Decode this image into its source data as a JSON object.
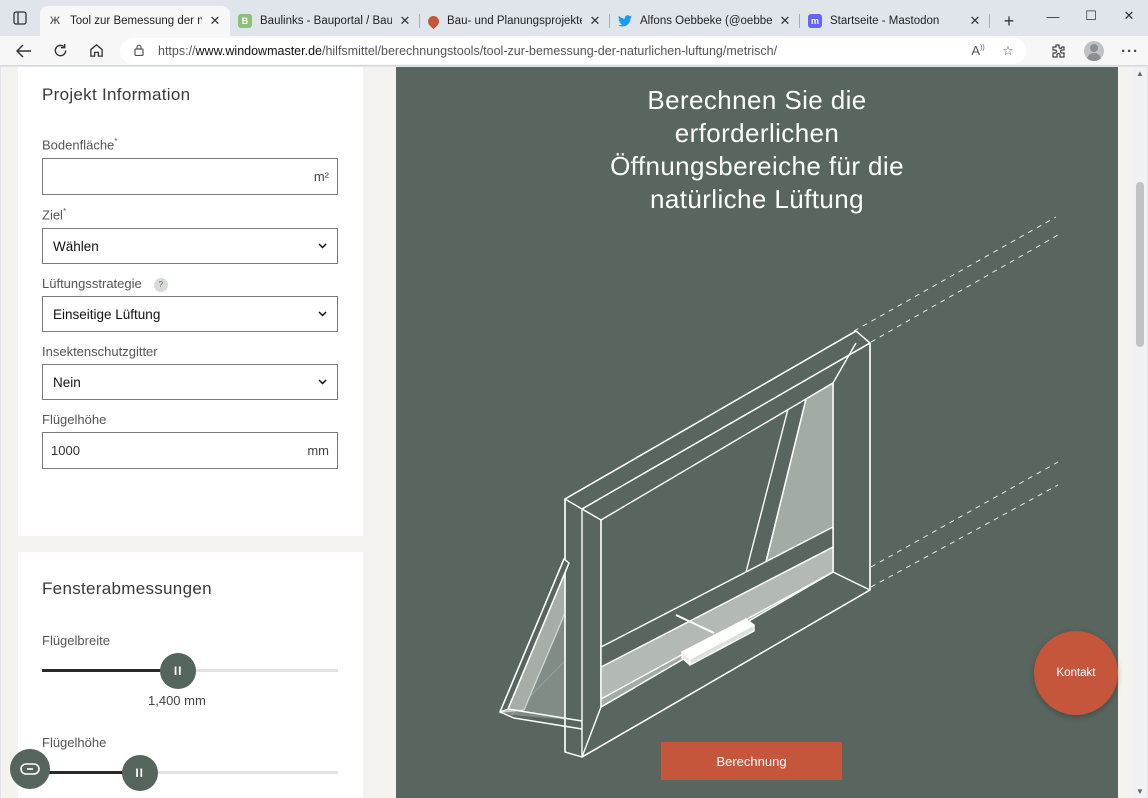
{
  "browser": {
    "tabs": [
      {
        "title": "Tool zur Bemessung der natürli",
        "favicon": "windowmaster-icon",
        "active": true
      },
      {
        "title": "Baulinks - Bauportal / Baumag",
        "favicon": "baulinks-icon",
        "active": false
      },
      {
        "title": "Bau- und Planungsprojekte au",
        "favicon": "maps-pin-icon",
        "active": false
      },
      {
        "title": "Alfons Oebbeke (@oebbeke) / ",
        "favicon": "twitter-icon",
        "active": false
      },
      {
        "title": "Startseite - Mastodon",
        "favicon": "mastodon-icon",
        "active": false
      }
    ],
    "url_prefix": "https://",
    "url_host": "www.windowmaster.de",
    "url_path": "/hilfsmittel/berechnungstools/tool-zur-bemessung-der-naturlichen-luftung/metrisch/"
  },
  "form": {
    "section1_title": "Projekt Information",
    "bodenflaeche_label": "Bodenfläche",
    "bodenflaeche_required": "*",
    "bodenflaeche_value": "",
    "bodenflaeche_unit": "m²",
    "ziel_label": "Ziel",
    "ziel_required": "*",
    "ziel_value": "Wählen",
    "strategie_label": "Lüftungsstrategie",
    "strategie_help": "?",
    "strategie_value": "Einseitige Lüftung",
    "insekt_label": "Insektenschutzgitter",
    "insekt_value": "Nein",
    "fluegelhoehe_label": "Flügelhöhe",
    "fluegelhoehe_value": "1000",
    "fluegelhoehe_unit": "mm",
    "section2_title": "Fensterabmessungen",
    "breite_label": "Flügelbreite",
    "breite_value": "1,400 mm",
    "breite_fraction": 0.46,
    "hoehe2_label": "Flügelhöhe",
    "hoehe2_fraction": 0.33
  },
  "hero": {
    "title": "Berechnen Sie die erforderlichen Öffnungsbereiche für die natürliche Lüftung",
    "calc_button": "Berechnung"
  },
  "kontakt_label": "Kontakt",
  "colors": {
    "hero_bg": "#58665f",
    "accent": "#c5553b",
    "knob": "#55655c"
  }
}
